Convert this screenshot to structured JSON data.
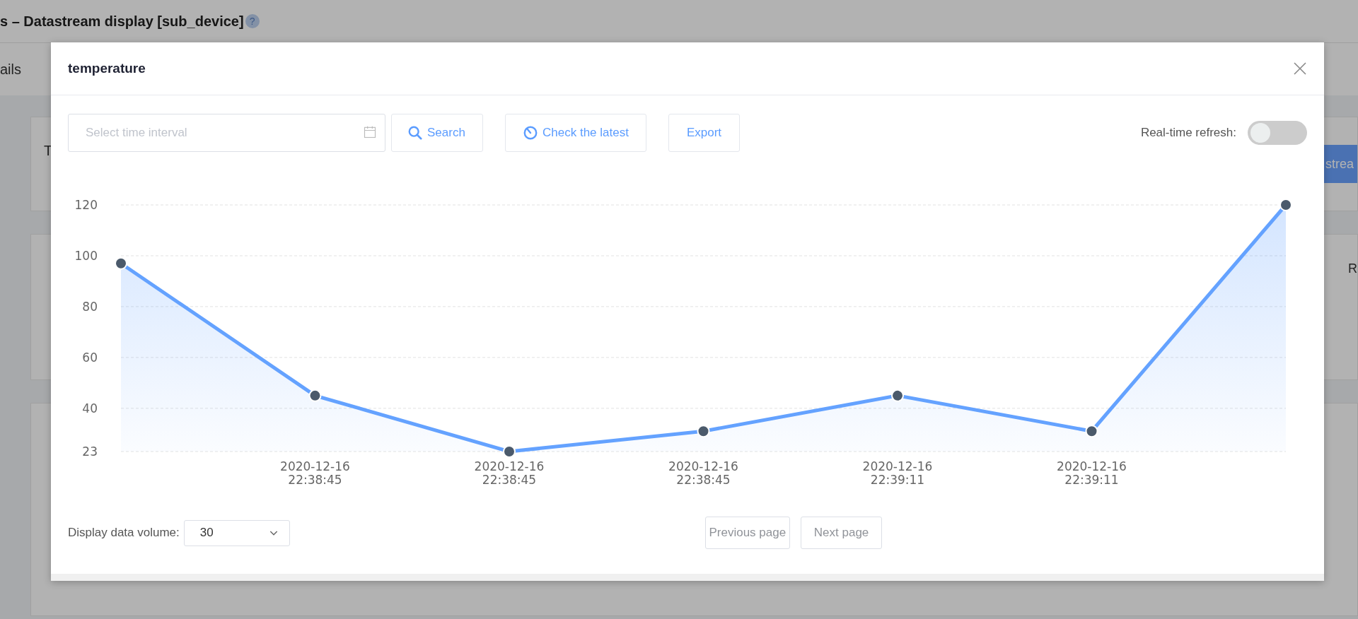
{
  "page": {
    "header_title": "s – Datastream display [sub_device]",
    "help_icon": "?",
    "tab_label": "ails",
    "card_label": "T",
    "card_button": "strea",
    "side_label": "R"
  },
  "dialog": {
    "title": "temperature",
    "time_field": {
      "placeholder": "Select time interval"
    },
    "buttons": [
      {
        "kind": "search",
        "label": "Search"
      },
      {
        "kind": "latest",
        "label": "Check the latest"
      },
      {
        "kind": "plain",
        "label": "Export"
      }
    ],
    "realtime": {
      "label": "Real-time refresh:",
      "on": false
    },
    "chart_data": {
      "type": "area",
      "categories": [
        null,
        "2020-12-16 22:38:45",
        "2020-12-16 22:38:45",
        "2020-12-16 22:38:45",
        "2020-12-16 22:39:11",
        "2020-12-16 22:39:11",
        null
      ],
      "series": [
        {
          "color": "#64a2ff",
          "values": [
            97,
            45,
            23,
            31,
            45,
            31,
            120
          ]
        }
      ],
      "ylim": [
        23,
        120
      ],
      "grid": true,
      "yticks": [
        23,
        40,
        60,
        80,
        100,
        120
      ]
    },
    "volume": {
      "label": "Display data volume:",
      "value": "30"
    },
    "pager": [
      {
        "label": "Previous page"
      },
      {
        "label": "Next page"
      }
    ]
  }
}
